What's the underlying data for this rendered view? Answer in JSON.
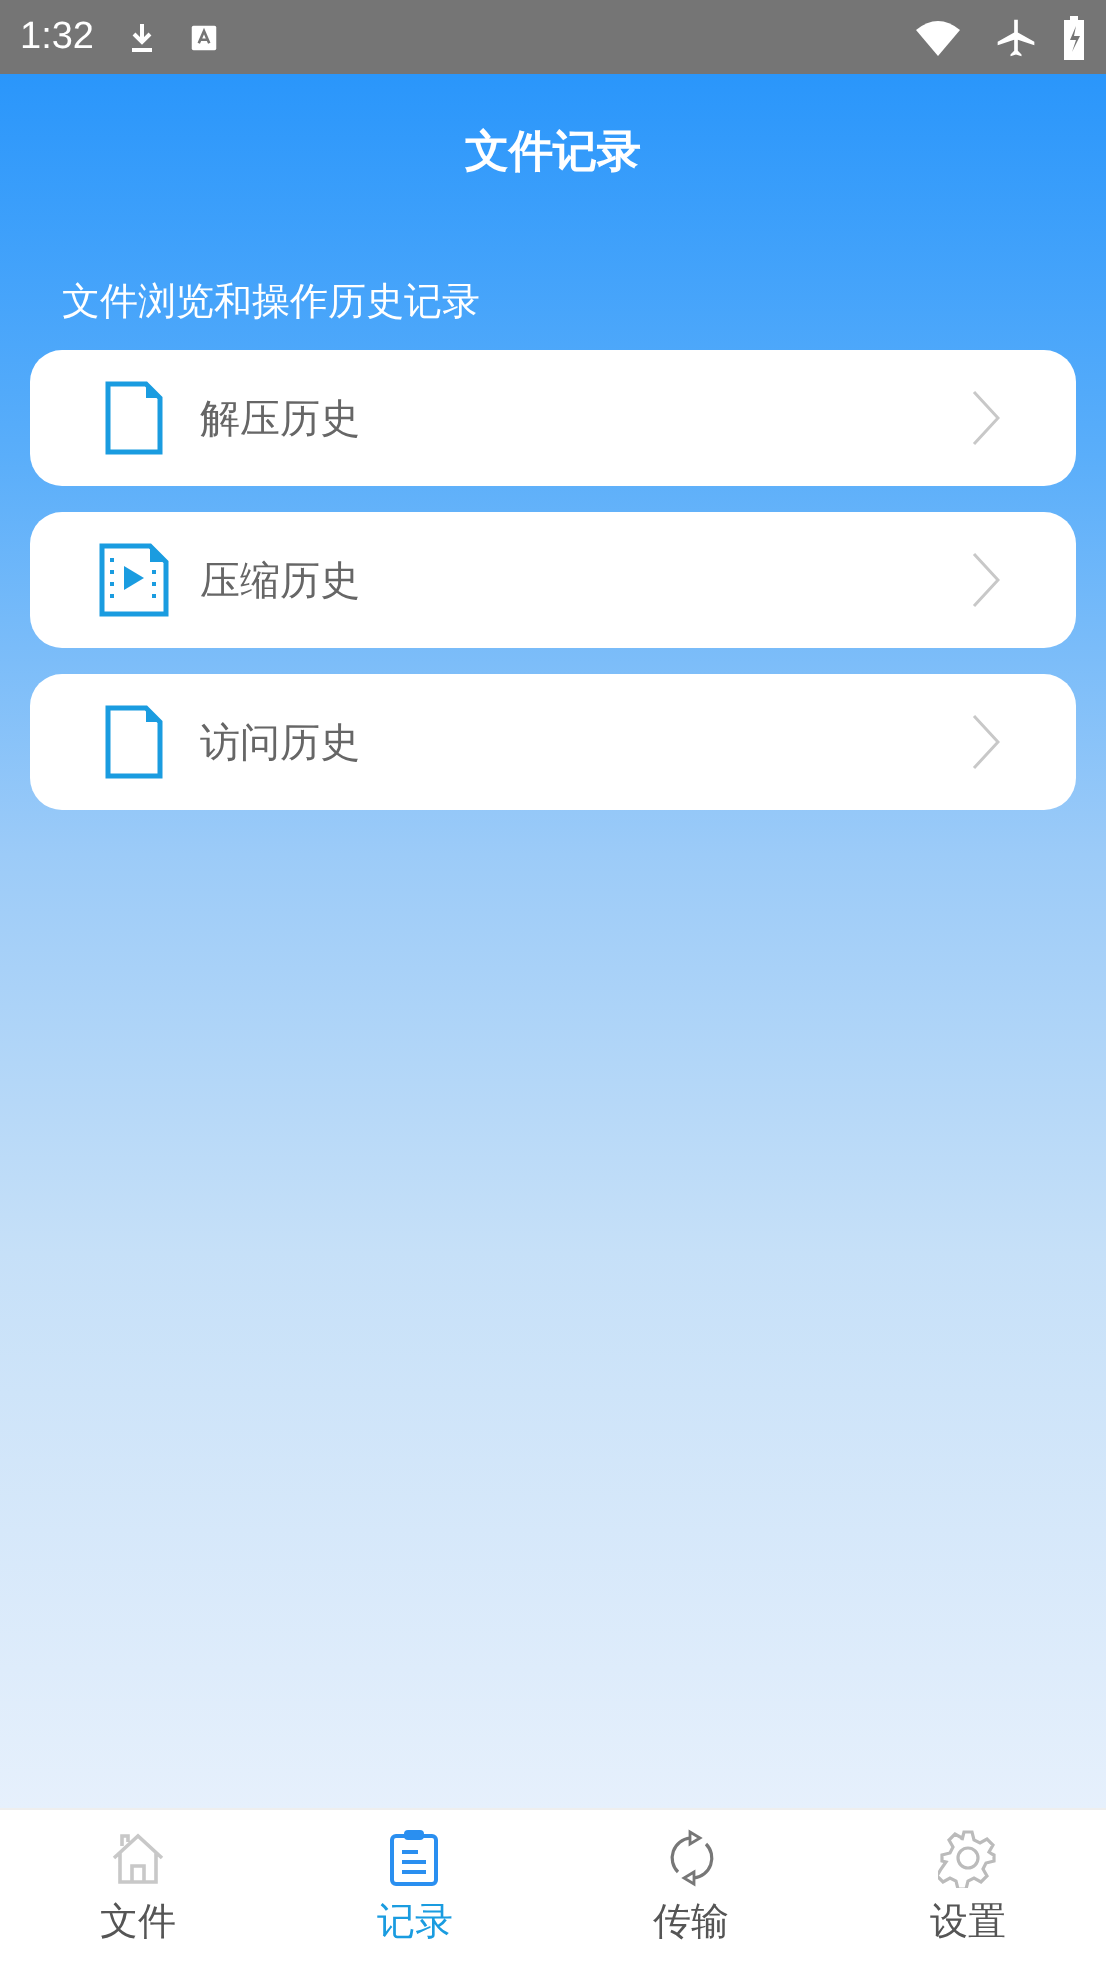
{
  "status_bar": {
    "time": "1:32"
  },
  "header": {
    "title": "文件记录"
  },
  "section": {
    "title": "文件浏览和操作历史记录"
  },
  "items": [
    {
      "label": "解压历史",
      "kind": "document"
    },
    {
      "label": "压缩历史",
      "kind": "video"
    },
    {
      "label": "访问历史",
      "kind": "document"
    }
  ],
  "tabs": [
    {
      "label": "文件",
      "kind": "home",
      "selected": false
    },
    {
      "label": "记录",
      "kind": "clipboard",
      "selected": true
    },
    {
      "label": "传输",
      "kind": "sync",
      "selected": false
    },
    {
      "label": "设置",
      "kind": "gear",
      "selected": false
    }
  ]
}
